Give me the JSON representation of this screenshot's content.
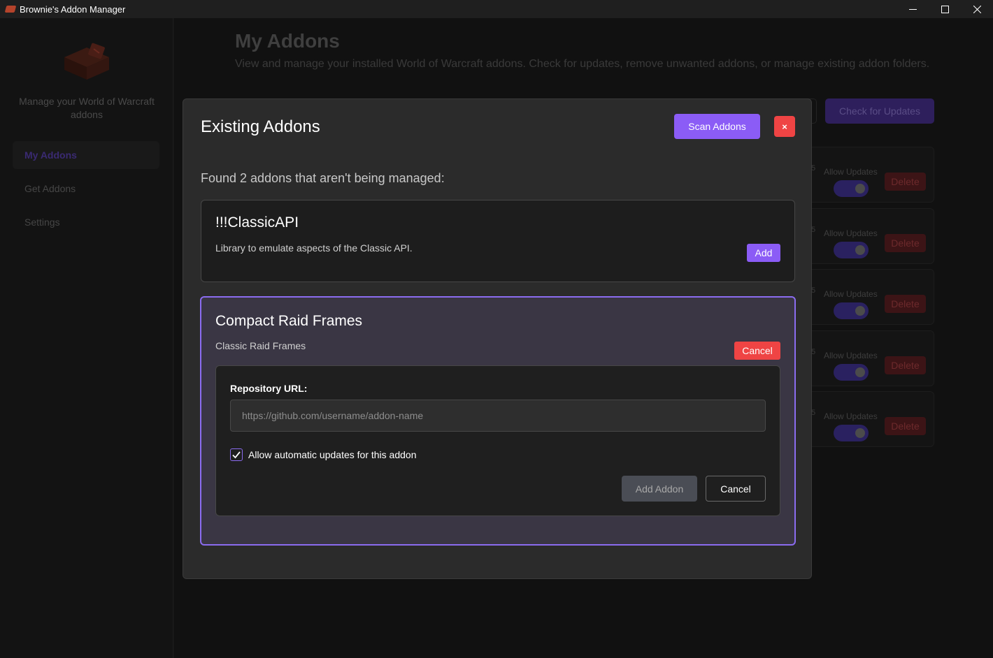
{
  "window": {
    "title": "Brownie's Addon Manager",
    "controls": [
      "minimize-icon",
      "maximize-icon",
      "close-icon"
    ]
  },
  "sidebar": {
    "tagline": "Manage your World of Warcraft addons",
    "items": [
      {
        "label": "My Addons",
        "active": true
      },
      {
        "label": "Get Addons",
        "active": false
      },
      {
        "label": "Settings",
        "active": false
      }
    ]
  },
  "page": {
    "title": "My Addons",
    "subtitle": "View and manage your installed World of Warcraft addons. Check for updates, remove unwanted addons, or manage existing addon folders.",
    "check_updates_label": "Check for Updates"
  },
  "addon_rows": [
    {
      "fragment": "5",
      "allow_label": "Allow Updates",
      "delete_label": "Delete",
      "allow_updates": true
    },
    {
      "fragment": "5",
      "allow_label": "Allow Updates",
      "delete_label": "Delete",
      "allow_updates": true
    },
    {
      "fragment": "5",
      "allow_label": "Allow Updates",
      "delete_label": "Delete",
      "allow_updates": true
    },
    {
      "fragment": "5",
      "allow_label": "Allow Updates",
      "delete_label": "Delete",
      "allow_updates": true
    },
    {
      "fragment": "5",
      "allow_label": "Allow Updates",
      "delete_label": "Delete",
      "allow_updates": true
    }
  ],
  "modal": {
    "title": "Existing Addons",
    "scan_label": "Scan Addons",
    "close_label": "×",
    "found_text": "Found 2 addons that aren't being managed:",
    "addons": [
      {
        "name": "!!!ClassicAPI",
        "description": "Library to emulate aspects of the Classic API.",
        "action_label": "Add"
      },
      {
        "name": "Compact Raid Frames",
        "description": "Classic Raid Frames",
        "action_label": "Cancel",
        "form": {
          "repo_label": "Repository URL:",
          "repo_value": "",
          "repo_placeholder": "https://github.com/username/addon-name",
          "auto_update_checked": true,
          "auto_update_label": "Allow automatic updates for this addon",
          "submit_label": "Add Addon",
          "cancel_label": "Cancel"
        }
      }
    ]
  },
  "colors": {
    "accent": "#8b5cf6",
    "danger": "#ef4444",
    "modal_bg": "#2b2b2b",
    "app_bg": "#111111"
  }
}
